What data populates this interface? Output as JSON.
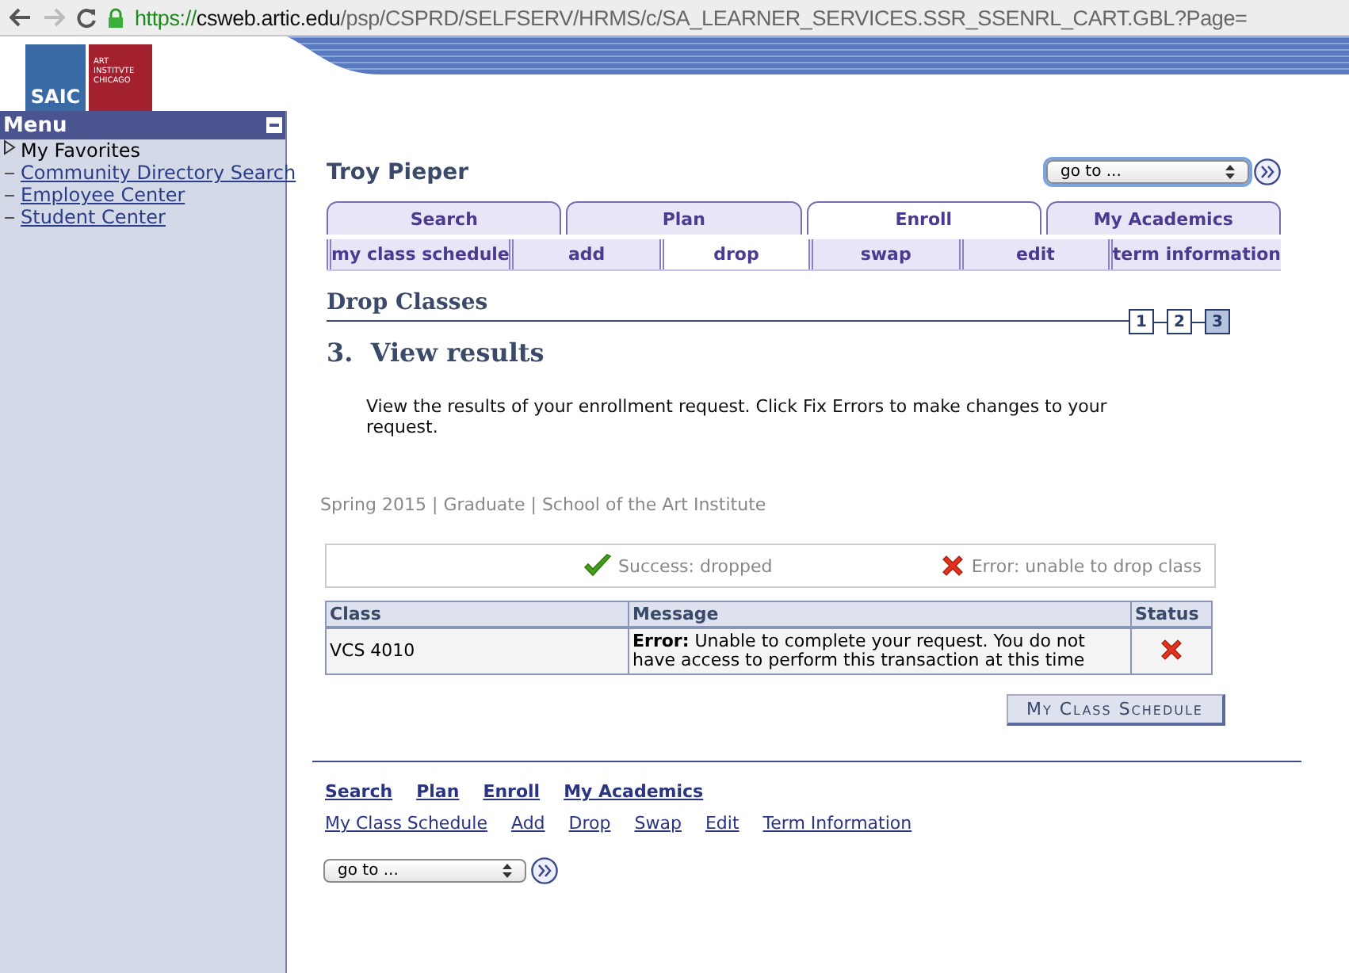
{
  "browser": {
    "url_scheme": "https://",
    "url_host": "csweb.artic.edu",
    "url_path": "/psp/CSPRD/SELFSERV/HRMS/c/SA_LEARNER_SERVICES.SSR_SSENRL_CART.GBL?Page="
  },
  "logos": {
    "short": "SAIC",
    "long_lines": [
      "ART",
      "INSTITVTE",
      "CHICAGO"
    ]
  },
  "sidebar": {
    "title": "Menu",
    "items": [
      {
        "label": "My Favorites",
        "kind": "folder"
      },
      {
        "label": "Community Directory Search",
        "kind": "link"
      },
      {
        "label": "Employee Center",
        "kind": "link"
      },
      {
        "label": "Student Center",
        "kind": "link"
      }
    ]
  },
  "user_name": "Troy Pieper",
  "goto_top": {
    "value": "go to ..."
  },
  "tabs": [
    {
      "label": "Search",
      "selected": false
    },
    {
      "label": "Plan",
      "selected": false
    },
    {
      "label": "Enroll",
      "selected": true
    },
    {
      "label": "My Academics",
      "selected": false
    }
  ],
  "subtabs": [
    {
      "label": "my class schedule",
      "selected": false
    },
    {
      "label": "add",
      "selected": false
    },
    {
      "label": "drop",
      "selected": true
    },
    {
      "label": "swap",
      "selected": false
    },
    {
      "label": "edit",
      "selected": false
    },
    {
      "label": "term information",
      "selected": false
    }
  ],
  "page_title": "Drop Classes",
  "steps": [
    {
      "label": "1",
      "selected": false
    },
    {
      "label": "2",
      "selected": false
    },
    {
      "label": "3",
      "selected": true
    }
  ],
  "step_title": "3.  View results",
  "instructions": "View the results of your enrollment request.  Click Fix Errors to make changes to your request.",
  "term_info": "Spring 2015 | Graduate | School of the Art Institute",
  "legend": [
    {
      "kind": "success",
      "label": "Success: dropped"
    },
    {
      "kind": "error",
      "label": "Error: unable to drop class"
    }
  ],
  "table": {
    "columns": [
      "Class",
      "Message",
      "Status"
    ],
    "rows": [
      {
        "class": "VCS 4010",
        "message": "**Error:** Unable to complete your request. You do not have access to perform this transaction at this time",
        "kind": "error"
      }
    ]
  },
  "schedule_button": "My Class Schedule",
  "footer_links": {
    "primary": [
      "Search",
      "Plan",
      "Enroll",
      "My Academics"
    ],
    "secondary": [
      "My Class Schedule",
      "Add",
      "Drop",
      "Swap",
      "Edit",
      "Term Information"
    ]
  },
  "goto_bottom": {
    "value": "go to ..."
  }
}
